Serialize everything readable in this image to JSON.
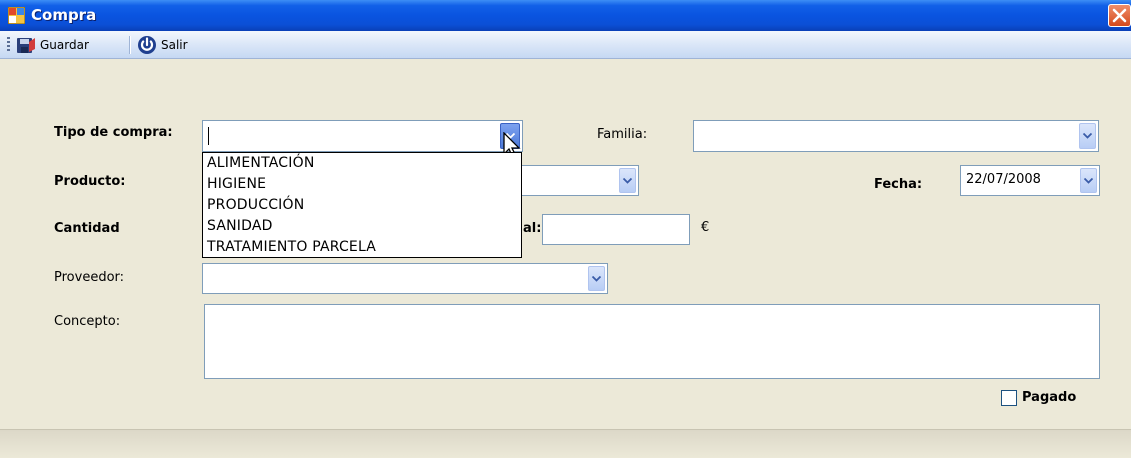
{
  "window": {
    "title": "Compra"
  },
  "toolbar": {
    "save_label": "Guardar",
    "exit_label": "Salir"
  },
  "form": {
    "tipo_compra": {
      "label": "Tipo de compra:",
      "value": ""
    },
    "familia": {
      "label": "Familia:",
      "value": ""
    },
    "producto": {
      "label": "Producto:",
      "value": ""
    },
    "fecha": {
      "label": "Fecha:",
      "value": "22/07/2008"
    },
    "cantidad": {
      "label": "Cantidad",
      "value": ""
    },
    "total": {
      "label_fragment": "al:",
      "value": "",
      "currency": "€"
    },
    "proveedor": {
      "label": "Proveedor:",
      "value": ""
    },
    "concepto": {
      "label": "Concepto:",
      "value": ""
    },
    "pagado": {
      "label": "Pagado",
      "checked": false
    }
  },
  "tipo_compra_options": [
    "ALIMENTACIÓN",
    "HIGIENE",
    "PRODUCCIÓN",
    "SANIDAD",
    "TRATAMIENTO PARCELA"
  ],
  "colors": {
    "titlebar": "#0a54e0",
    "form_bg": "#ece9d8",
    "field_border": "#7f9db9"
  }
}
